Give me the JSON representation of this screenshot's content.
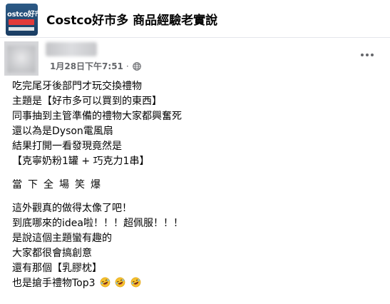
{
  "group": {
    "name": "Costco好市多 商品經驗老實說",
    "avatar_text": "ostco好市"
  },
  "post": {
    "date": "1月28日下午7:51",
    "separator": "·",
    "icon": "globe-icon",
    "more_icon": "more-options-icon",
    "lines_block1": [
      "吃完尾牙後部門才玩交換禮物",
      "主題是【好市多可以買到的東西】",
      "同事抽到主管準備的禮物大家都興奮死",
      "還以為是Dyson電風扇",
      "結果打開一看發現竟然是",
      "【克寧奶粉1罐 + 巧克力1串】"
    ],
    "line_spaced": "當下全場笑爆",
    "lines_block2": [
      "這外觀真的做得太像了吧！",
      "到底哪來的idea啦！！！超佩服！！！",
      "是說這個主題蠻有趣的",
      "大家都很會搞創意",
      "還有那個【乳膠枕】"
    ],
    "last_line": "也是搶手禮物Top3",
    "emoji_icon": "rolling-on-floor-laughing-icon",
    "emoji_count": 3
  }
}
